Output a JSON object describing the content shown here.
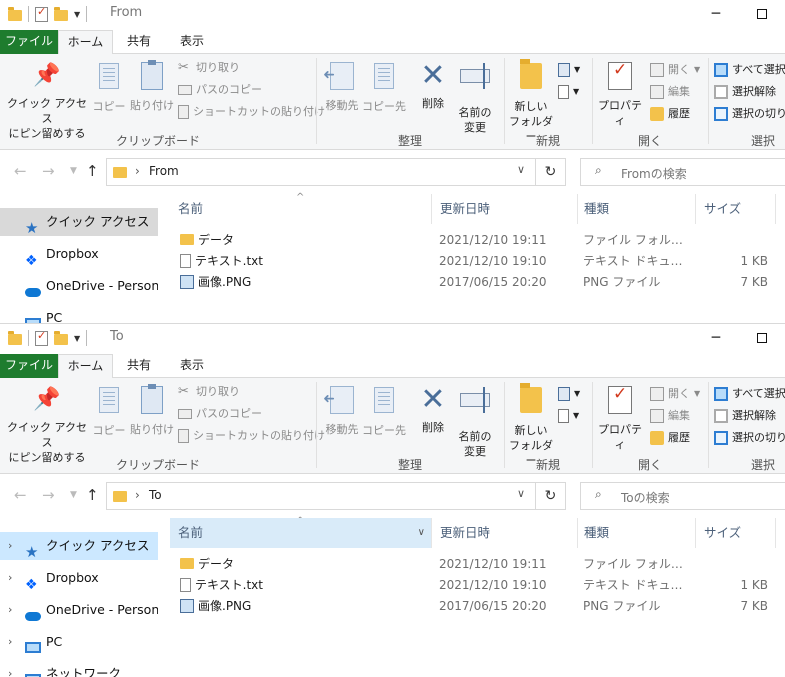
{
  "windows": [
    {
      "title": "From",
      "ribbon": {
        "tabs": [
          "ファイル",
          "ホーム",
          "共有",
          "表示"
        ],
        "clipboard": {
          "pin": "クイック アクセス\nにピン留めする",
          "copy": "コピー",
          "paste": "貼り付け",
          "cut": "切り取り",
          "copy_path": "パスのコピー",
          "paste_shortcut": "ショートカットの貼り付け",
          "label": "クリップボード"
        },
        "organize": {
          "move_to": "移動先",
          "copy_to": "コピー先",
          "delete": "削除",
          "rename": "名前の\n変更",
          "label": "整理"
        },
        "new": {
          "new_folder": "新しい\nフォルダー",
          "label": "新規"
        },
        "open": {
          "properties": "プロパティ",
          "open": "開く",
          "edit": "編集",
          "history": "履歴",
          "label": "開く"
        },
        "select": {
          "select_all": "すべて選択",
          "select_none": "選択解除",
          "invert": "選択の切り替え",
          "label": "選択"
        }
      },
      "address": {
        "crumb": "From",
        "search_placeholder": "Fromの検索"
      },
      "nav": [
        "クイック アクセス",
        "Dropbox",
        "OneDrive - Personal",
        "PC"
      ],
      "columns": [
        "名前",
        "更新日時",
        "種類",
        "サイズ"
      ],
      "files": [
        {
          "name": "データ",
          "date": "2021/12/10 19:11",
          "type": "ファイル フォルダー",
          "size": "",
          "icon": "folder"
        },
        {
          "name": "テキスト.txt",
          "date": "2021/12/10 19:10",
          "type": "テキスト ドキュメント",
          "size": "1 KB",
          "icon": "txt"
        },
        {
          "name": "画像.PNG",
          "date": "2017/06/15 20:20",
          "type": "PNG ファイル",
          "size": "7 KB",
          "icon": "img"
        }
      ]
    },
    {
      "title": "To",
      "ribbon": {
        "tabs": [
          "ファイル",
          "ホーム",
          "共有",
          "表示"
        ],
        "clipboard": {
          "pin": "クイック アクセス\nにピン留めする",
          "copy": "コピー",
          "paste": "貼り付け",
          "cut": "切り取り",
          "copy_path": "パスのコピー",
          "paste_shortcut": "ショートカットの貼り付け",
          "label": "クリップボード"
        },
        "organize": {
          "move_to": "移動先",
          "copy_to": "コピー先",
          "delete": "削除",
          "rename": "名前の\n変更",
          "label": "整理"
        },
        "new": {
          "new_folder": "新しい\nフォルダー",
          "label": "新規"
        },
        "open": {
          "properties": "プロパティ",
          "open": "開く",
          "edit": "編集",
          "history": "履歴",
          "label": "開く"
        },
        "select": {
          "select_all": "すべて選択",
          "select_none": "選択解除",
          "invert": "選択の切り替え",
          "label": "選択"
        }
      },
      "address": {
        "crumb": "To",
        "search_placeholder": "Toの検索"
      },
      "nav": [
        "クイック アクセス",
        "Dropbox",
        "OneDrive - Personal",
        "PC",
        "ネットワーク"
      ],
      "columns": [
        "名前",
        "更新日時",
        "種類",
        "サイズ"
      ],
      "files": [
        {
          "name": "データ",
          "date": "2021/12/10 19:11",
          "type": "ファイル フォルダー",
          "size": "",
          "icon": "folder"
        },
        {
          "name": "テキスト.txt",
          "date": "2021/12/10 19:10",
          "type": "テキスト ドキュメント",
          "size": "1 KB",
          "icon": "txt"
        },
        {
          "name": "画像.PNG",
          "date": "2017/06/15 20:20",
          "type": "PNG ファイル",
          "size": "7 KB",
          "icon": "img"
        }
      ]
    }
  ]
}
